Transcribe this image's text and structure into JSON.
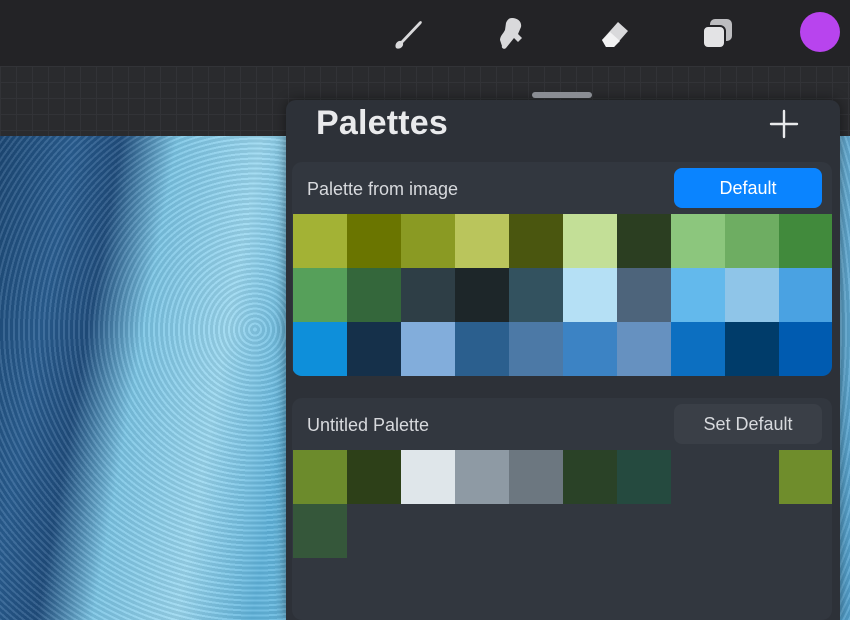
{
  "toolbar": {
    "tools": [
      {
        "name": "brush-icon"
      },
      {
        "name": "smudge-icon"
      },
      {
        "name": "eraser-icon"
      },
      {
        "name": "layers-icon"
      }
    ],
    "current_color": "#b844ee"
  },
  "panel": {
    "title": "Palettes",
    "add_icon": "plus-icon"
  },
  "palettes": [
    {
      "name": "Palette from image",
      "button_label": "Default",
      "is_default": true,
      "swatches": [
        "#a3b235",
        "#6a7500",
        "#8a9a23",
        "#bac55c",
        "#4a560f",
        "#c3df97",
        "#2b3e21",
        "#8cc67d",
        "#6ead62",
        "#418a3c",
        "#56a05a",
        "#34673b",
        "#2e3e46",
        "#1d2629",
        "#33525f",
        "#b5e0f5",
        "#4d647b",
        "#63b9ec",
        "#8fc5e8",
        "#4aa2e2",
        "#0e8fda",
        "#15304a",
        "#82addb",
        "#2b5f8e",
        "#4c79a6",
        "#3c83c4",
        "#6691c0",
        "#0c6fc1",
        "#003c6a",
        "#005bb0"
      ]
    },
    {
      "name": "Untitled Palette",
      "button_label": "Set Default",
      "is_default": false,
      "swatches": [
        "#6c8b2c",
        "#2d4018",
        "#dfe6ea",
        "#8e9aa4",
        "#6c7780",
        "#2a4227",
        "#254a3f",
        null,
        null,
        "#6f8d2c",
        "#35573a"
      ]
    }
  ]
}
